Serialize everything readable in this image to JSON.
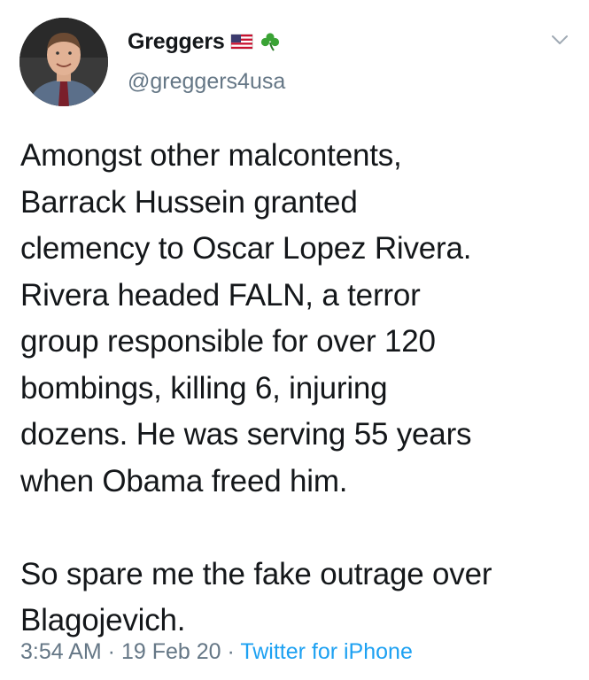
{
  "author": {
    "display_name": "Greggers",
    "handle": "@greggers4usa",
    "name_emojis": [
      "us-flag-emoji",
      "shamrock-emoji"
    ]
  },
  "tweet": {
    "paragraph_1": "Amongst other malcontents,\nBarrack Hussein granted\nclemency to Oscar Lopez Rivera.\nRivera headed FALN, a terror\ngroup responsible for over 120\nbombings, killing 6, injuring\ndozens.  He was serving 55 years\nwhen Obama freed him.",
    "paragraph_2": "So spare me the fake outrage over\nBlagojevich."
  },
  "meta": {
    "time": "3:54 AM",
    "separator_1": " · ",
    "date": "19 Feb 20",
    "separator_2": " · ",
    "source": "Twitter for iPhone"
  },
  "colors": {
    "text": "#14171a",
    "secondary": "#657786",
    "link": "#1da1f2"
  }
}
